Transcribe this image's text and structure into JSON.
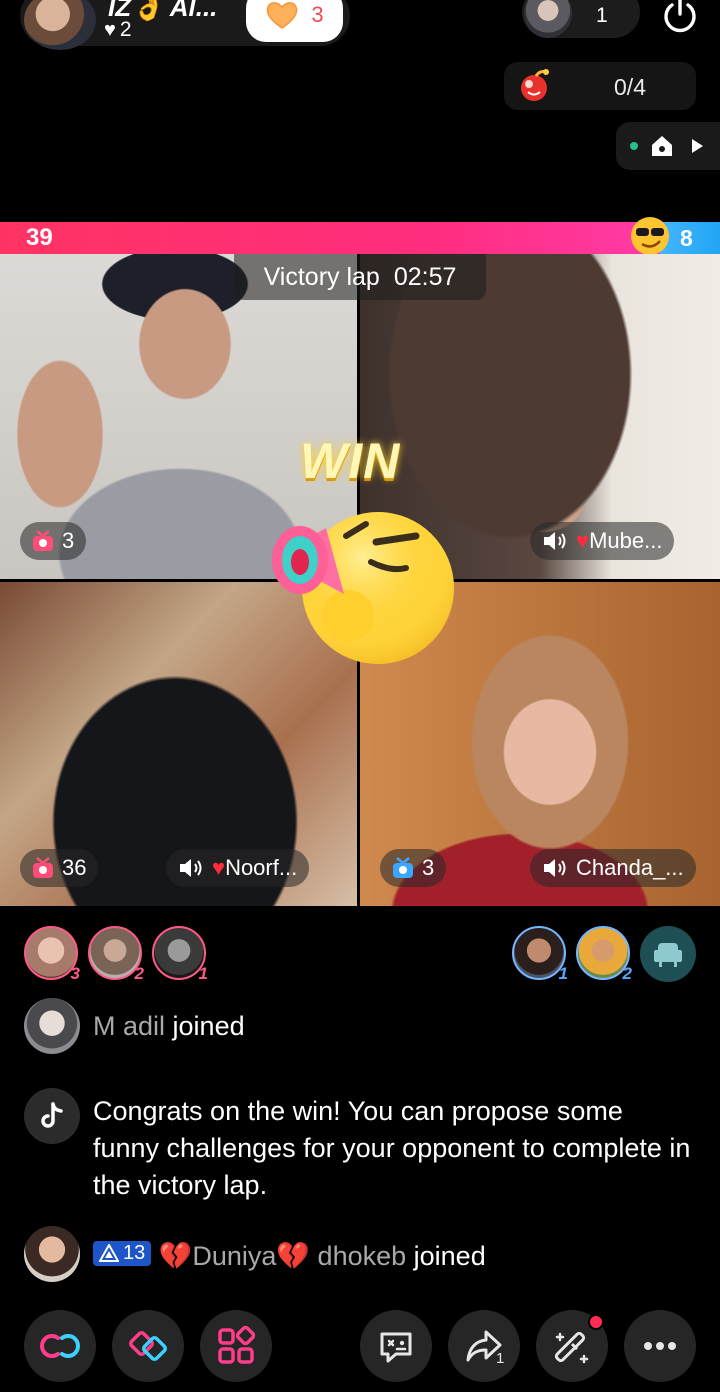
{
  "host": {
    "name": "ĪŽ👌 Al...",
    "likes": "2",
    "follow_count": "3"
  },
  "viewers": {
    "count": "1"
  },
  "goal": {
    "progress": "0/4",
    "current": 0,
    "target": 4
  },
  "battle": {
    "score_left": "39",
    "score_right": "8",
    "timer_label": "Victory lap",
    "timer_value": "02:57",
    "win_label": "WIN"
  },
  "tiles": [
    {
      "gift_count": "3"
    },
    {
      "name": "Mube..."
    },
    {
      "gift_count": "36",
      "name": "Noorf..."
    },
    {
      "gift_count": "3",
      "name": "Chanda_..."
    }
  ],
  "gifters_left": [
    {
      "rank": "3"
    },
    {
      "rank": "2"
    },
    {
      "rank": "1"
    }
  ],
  "gifters_right": [
    {
      "rank": "1"
    },
    {
      "rank": "2"
    }
  ],
  "chat": {
    "join1": {
      "user": "M adil",
      "action": "joined"
    },
    "system": "Congrats on the win! You can propose some funny challenges for your opponent to complete in the victory lap.",
    "join2": {
      "level": "13",
      "user": "💔Duniya💔 dhokeb",
      "action": "joined"
    }
  },
  "toolbar": {
    "share_count": "1"
  },
  "colors": {
    "accent_pink": "#ff2d7f",
    "accent_blue": "#21a5f2",
    "background": "#000000"
  }
}
